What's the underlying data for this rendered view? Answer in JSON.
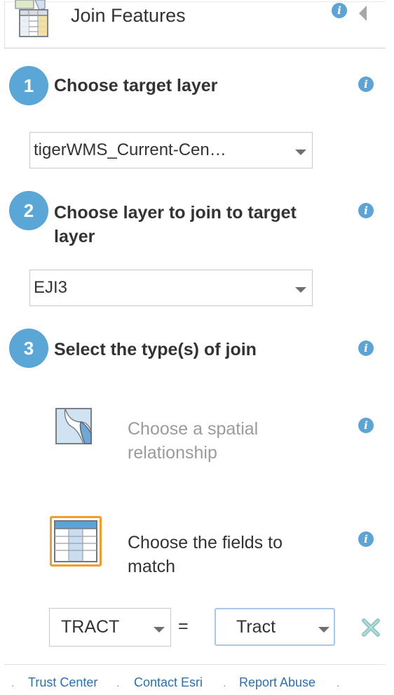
{
  "header": {
    "title": "Join Features"
  },
  "steps": [
    {
      "number": "1",
      "label": "Choose target layer"
    },
    {
      "number": "2",
      "label_line1": "Choose layer to join to target",
      "label_line2": "layer"
    },
    {
      "number": "3",
      "label": "Select the type(s) of join"
    }
  ],
  "target_layer": {
    "selected": "tigerWMS_Current-Cen…"
  },
  "join_layer": {
    "selected": "EJI3"
  },
  "join_types": {
    "spatial_line1": "Choose a spatial",
    "spatial_line2": "relationship",
    "fields_line1": "Choose the fields to",
    "fields_line2": "match"
  },
  "field_match": {
    "left_field": "TRACT",
    "operator": "=",
    "right_field": "Tract"
  },
  "footer": {
    "links": [
      "Trust Center",
      "Contact Esri",
      "Report Abuse"
    ]
  },
  "colors": {
    "accent": "#5aa6d6",
    "link": "#2a6fb4",
    "disabled_text": "#9b9b9b",
    "selected_border": "#f39c2a",
    "focus_border": "#a9c7ea",
    "remove_icon": "#8fc7c4"
  }
}
